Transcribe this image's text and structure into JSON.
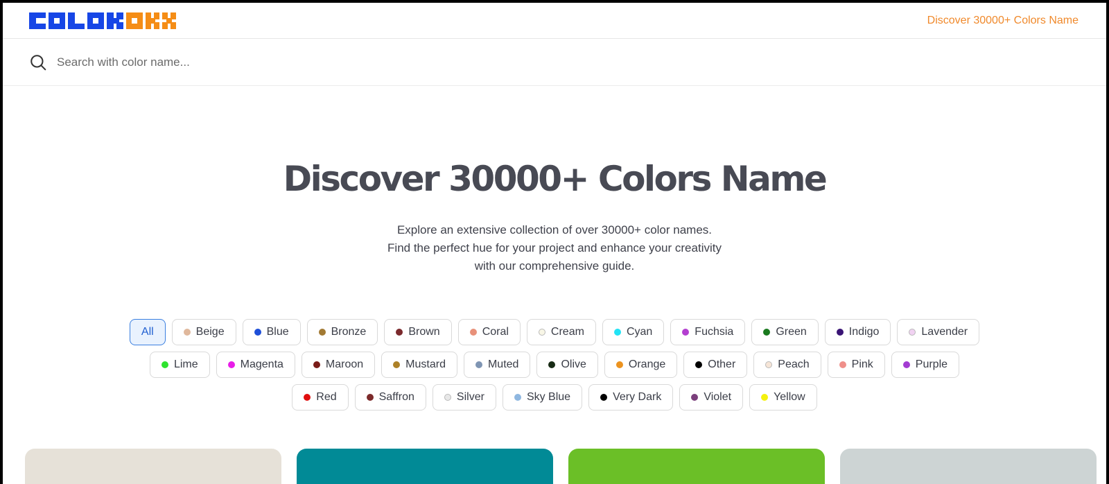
{
  "header": {
    "logo_alt": "COLORXX",
    "nav_link": "Discover 30000+ Colors Name"
  },
  "search": {
    "placeholder": "Search with color name..."
  },
  "hero": {
    "title": "Discover 30000+ Colors Name",
    "desc_line1": "Explore an extensive collection of over 30000+ color names.",
    "desc_line2": "Find the perfect hue for your project and enhance your creativity",
    "desc_line3": "with our comprehensive guide."
  },
  "filters": [
    {
      "label": "All",
      "active": true
    },
    {
      "label": "Beige",
      "color": "#e0b89c"
    },
    {
      "label": "Blue",
      "color": "#1e4fd8"
    },
    {
      "label": "Bronze",
      "color": "#a27a33"
    },
    {
      "label": "Brown",
      "color": "#7b2a2d"
    },
    {
      "label": "Coral",
      "color": "#e8917a"
    },
    {
      "label": "Cream",
      "color": "#f8f6e6"
    },
    {
      "label": "Cyan",
      "color": "#22e3f5"
    },
    {
      "label": "Fuchsia",
      "color": "#b33fd0"
    },
    {
      "label": "Green",
      "color": "#1a7a1f"
    },
    {
      "label": "Indigo",
      "color": "#3a1475"
    },
    {
      "label": "Lavender",
      "color": "#f1d2f2"
    },
    {
      "label": "Lime",
      "color": "#2ee32e"
    },
    {
      "label": "Magenta",
      "color": "#e81de8"
    },
    {
      "label": "Maroon",
      "color": "#7a1c18"
    },
    {
      "label": "Mustard",
      "color": "#ad8127"
    },
    {
      "label": "Muted",
      "color": "#7f95b3"
    },
    {
      "label": "Olive",
      "color": "#172a14"
    },
    {
      "label": "Orange",
      "color": "#ec931f"
    },
    {
      "label": "Other",
      "color": "#000000"
    },
    {
      "label": "Peach",
      "color": "#f6e5d7"
    },
    {
      "label": "Pink",
      "color": "#ef8f8a"
    },
    {
      "label": "Purple",
      "color": "#a33cd2"
    },
    {
      "label": "Red",
      "color": "#e00e0e"
    },
    {
      "label": "Saffron",
      "color": "#7c2a2a"
    },
    {
      "label": "Silver",
      "color": "#e8e8e8"
    },
    {
      "label": "Sky Blue",
      "color": "#8fb7e0"
    },
    {
      "label": "Very Dark",
      "color": "#000000"
    },
    {
      "label": "Violet",
      "color": "#7b3f7c"
    },
    {
      "label": "Yellow",
      "color": "#f4f10e"
    }
  ],
  "cards": [
    {
      "color": "#e6e1d8"
    },
    {
      "color": "#018a96"
    },
    {
      "color": "#6bbf27"
    },
    {
      "color": "#cdd4d4"
    }
  ],
  "colors": {
    "accent": "#f0892b",
    "logo_blue": "#1746e6",
    "logo_orange": "#f58d16",
    "title": "#484a54",
    "active_chip": "#3a7fe0"
  }
}
